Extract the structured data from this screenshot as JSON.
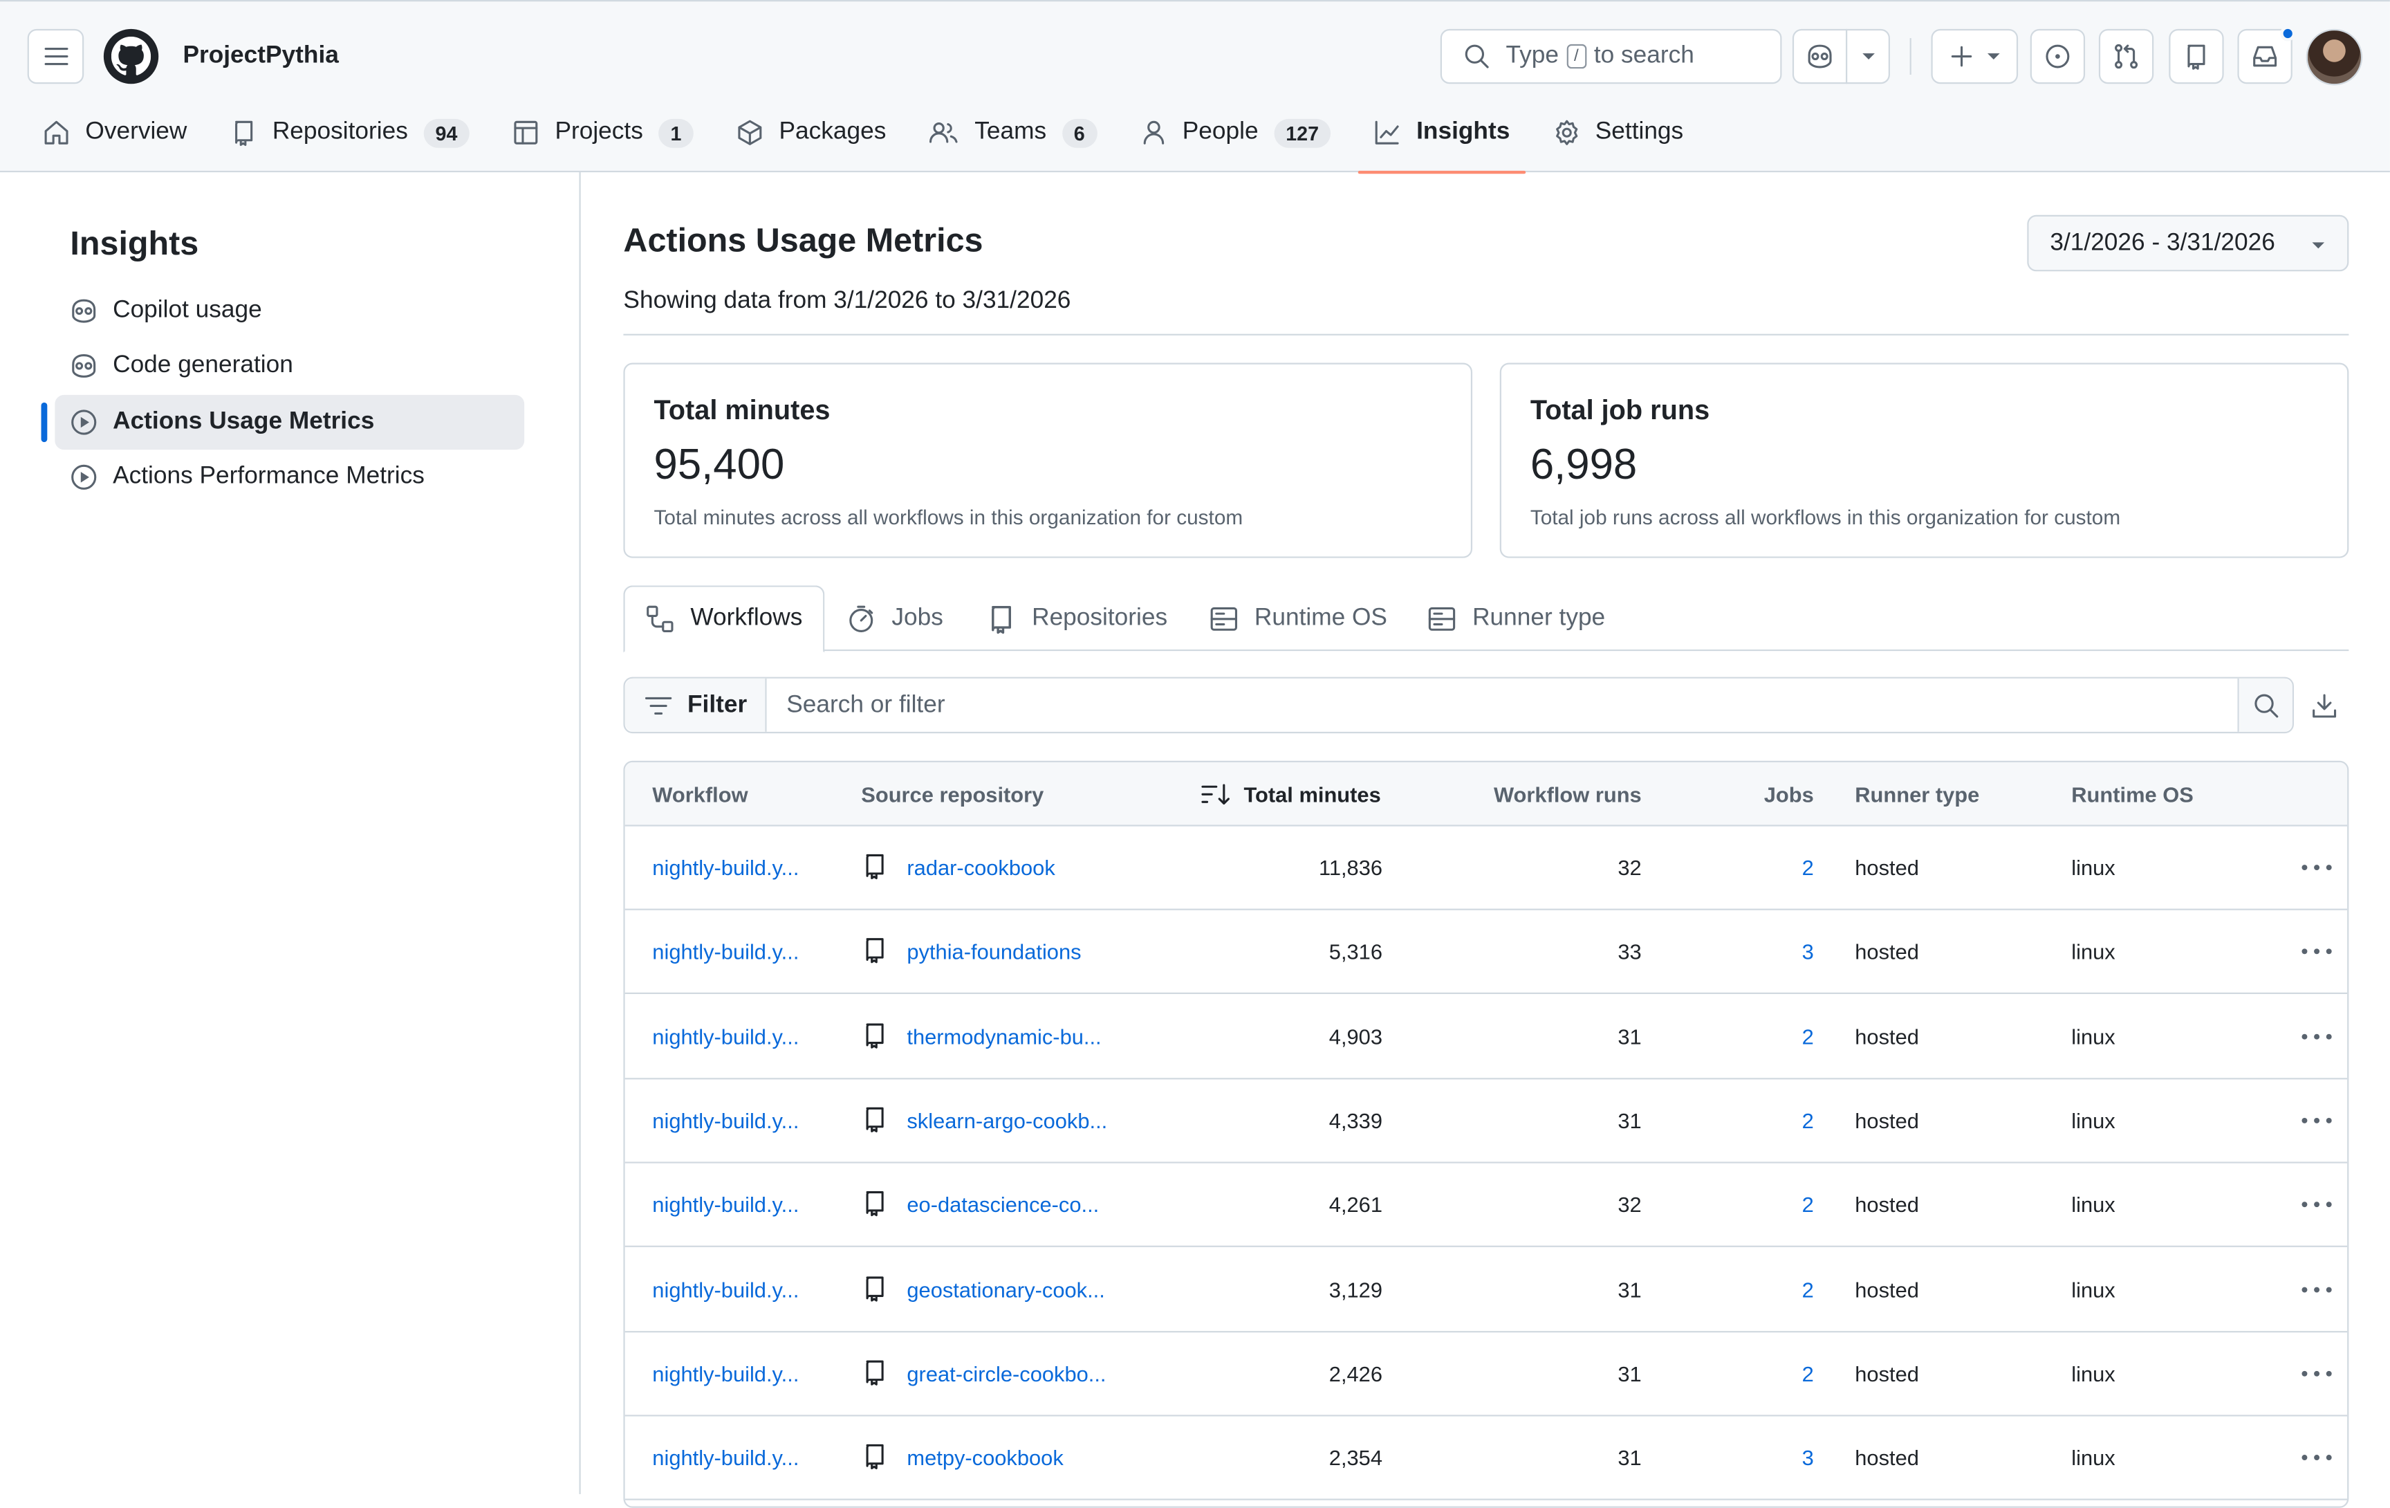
{
  "header": {
    "org_name": "ProjectPythia",
    "search_prefix": "Type",
    "search_key": "/",
    "search_suffix": "to search"
  },
  "nav": {
    "tabs": [
      {
        "label": "Overview"
      },
      {
        "label": "Repositories",
        "count": "94"
      },
      {
        "label": "Projects",
        "count": "1"
      },
      {
        "label": "Packages"
      },
      {
        "label": "Teams",
        "count": "6"
      },
      {
        "label": "People",
        "count": "127"
      },
      {
        "label": "Insights",
        "active": true
      },
      {
        "label": "Settings"
      }
    ]
  },
  "sidebar": {
    "title": "Insights",
    "items": [
      {
        "label": "Copilot usage",
        "icon": "copilot-icon"
      },
      {
        "label": "Code generation",
        "icon": "copilot-icon"
      },
      {
        "label": "Actions Usage Metrics",
        "icon": "play-icon",
        "active": true
      },
      {
        "label": "Actions Performance Metrics",
        "icon": "play-icon"
      }
    ]
  },
  "main": {
    "title": "Actions Usage Metrics",
    "date_range": "3/1/2026 - 3/31/2026",
    "subtitle": "Showing data from 3/1/2026 to 3/31/2026",
    "cards": [
      {
        "label": "Total minutes",
        "value": "95,400",
        "desc": "Total minutes across all workflows in this organization for custom"
      },
      {
        "label": "Total job runs",
        "value": "6,998",
        "desc": "Total job runs across all workflows in this organization for custom"
      }
    ],
    "subtabs": [
      "Workflows",
      "Jobs",
      "Repositories",
      "Runtime OS",
      "Runner type"
    ],
    "filter": {
      "label": "Filter",
      "placeholder": "Search or filter"
    }
  },
  "table": {
    "columns": [
      "Workflow",
      "Source repository",
      "Total minutes",
      "Workflow runs",
      "Jobs",
      "Runner type",
      "Runtime OS"
    ],
    "rows": [
      {
        "workflow": "nightly-build.y...",
        "repo": "radar-cookbook",
        "minutes": "11,836",
        "runs": "32",
        "jobs": "2",
        "runner": "hosted",
        "os": "linux"
      },
      {
        "workflow": "nightly-build.y...",
        "repo": "pythia-foundations",
        "minutes": "5,316",
        "runs": "33",
        "jobs": "3",
        "runner": "hosted",
        "os": "linux"
      },
      {
        "workflow": "nightly-build.y...",
        "repo": "thermodynamic-bu...",
        "minutes": "4,903",
        "runs": "31",
        "jobs": "2",
        "runner": "hosted",
        "os": "linux"
      },
      {
        "workflow": "nightly-build.y...",
        "repo": "sklearn-argo-cookb...",
        "minutes": "4,339",
        "runs": "31",
        "jobs": "2",
        "runner": "hosted",
        "os": "linux"
      },
      {
        "workflow": "nightly-build.y...",
        "repo": "eo-datascience-co...",
        "minutes": "4,261",
        "runs": "32",
        "jobs": "2",
        "runner": "hosted",
        "os": "linux"
      },
      {
        "workflow": "nightly-build.y...",
        "repo": "geostationary-cook...",
        "minutes": "3,129",
        "runs": "31",
        "jobs": "2",
        "runner": "hosted",
        "os": "linux"
      },
      {
        "workflow": "nightly-build.y...",
        "repo": "great-circle-cookbo...",
        "minutes": "2,426",
        "runs": "31",
        "jobs": "2",
        "runner": "hosted",
        "os": "linux"
      },
      {
        "workflow": "nightly-build.y...",
        "repo": "metpy-cookbook",
        "minutes": "2,354",
        "runs": "31",
        "jobs": "3",
        "runner": "hosted",
        "os": "linux"
      }
    ]
  }
}
